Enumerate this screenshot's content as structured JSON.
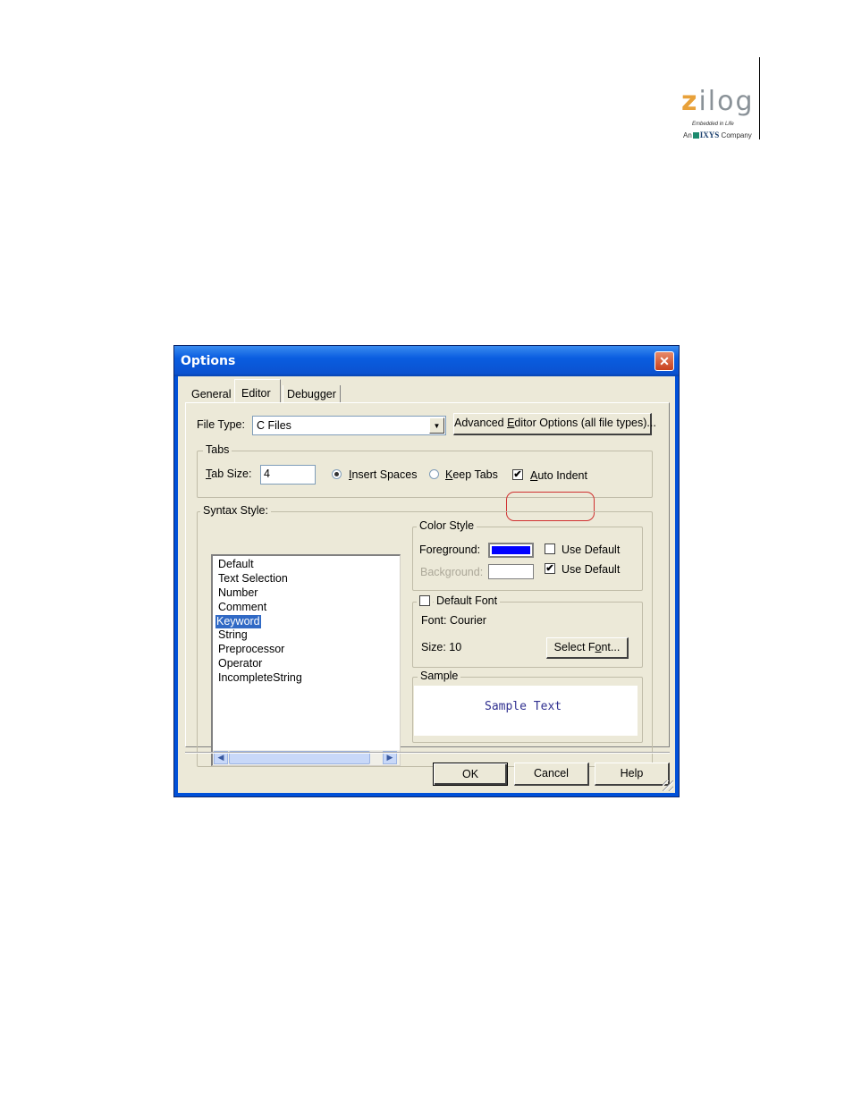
{
  "logo": {
    "word_z": "z",
    "word_rest": "ilog",
    "tagline": "Embedded in Life",
    "company_prefix": "An",
    "company_name": "IXYS",
    "company_suffix": "Company"
  },
  "window": {
    "title": "Options",
    "close_glyph": "✕"
  },
  "tabs": [
    {
      "label": "General",
      "active": false
    },
    {
      "label": "Editor",
      "active": true
    },
    {
      "label": "Debugger",
      "active": false
    }
  ],
  "file_type": {
    "label_pre": "File Type:",
    "value": "C Files",
    "advanced_button_pre": "Advanced ",
    "advanced_button_u": "E",
    "advanced_button_post": "ditor Options (all file types)..."
  },
  "tabs_group": {
    "title": "Tabs",
    "tab_size_u": "T",
    "tab_size_rest": "ab Size:",
    "tab_size_value": "4",
    "insert_spaces_u": "I",
    "insert_spaces_rest": "nsert Spaces",
    "insert_spaces_selected": true,
    "keep_tabs_u": "K",
    "keep_tabs_rest": "eep Tabs",
    "keep_tabs_selected": false,
    "auto_indent_u": "A",
    "auto_indent_rest": "uto Indent",
    "auto_indent_checked": true,
    "check_glyph": "✔"
  },
  "syntax_style": {
    "title": "Syntax Style:",
    "items": [
      {
        "label": "Default",
        "selected": false
      },
      {
        "label": "Text Selection",
        "selected": false
      },
      {
        "label": "Number",
        "selected": false
      },
      {
        "label": "Comment",
        "selected": false
      },
      {
        "label": "Keyword",
        "selected": true
      },
      {
        "label": "String",
        "selected": false
      },
      {
        "label": "Preprocessor",
        "selected": false
      },
      {
        "label": "Operator",
        "selected": false
      },
      {
        "label": "IncompleteString",
        "selected": false
      }
    ],
    "scroll_left": "◀",
    "scroll_right": "▶"
  },
  "color_style": {
    "title": "Color Style",
    "foreground_label": "Foreground:",
    "foreground_color": "#0000ff",
    "foreground_use_default_label": "Use Default",
    "foreground_use_default_checked": false,
    "background_label": "Background:",
    "background_color": "#ffffff",
    "background_use_default_label": "Use Default",
    "background_use_default_checked": true
  },
  "font_group": {
    "default_font_label": "Default Font",
    "default_font_checked": false,
    "font_label": "Font: Courier",
    "size_label": "Size: 10",
    "select_font_pre": "Select F",
    "select_font_u": "o",
    "select_font_post": "nt..."
  },
  "sample": {
    "title": "Sample",
    "text": "Sample Text"
  },
  "footer": {
    "ok": "OK",
    "cancel": "Cancel",
    "help": "Help"
  }
}
